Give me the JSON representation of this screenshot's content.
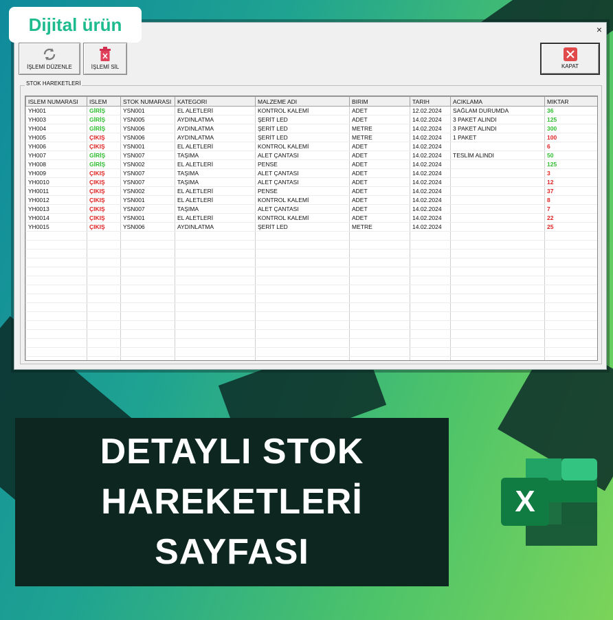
{
  "badge": "Dijital ürün",
  "window": {
    "close_glyph": "×"
  },
  "toolbar": {
    "edit_label": "İŞLEMİ DÜZENLE",
    "delete_label": "İŞLEMİ SİL",
    "close_label": "KAPAT"
  },
  "group_title": "STOK HAREKETLERİ",
  "table": {
    "columns": [
      "ISLEM NUMARASI",
      "ISLEM",
      "STOK NUMARASI",
      "KATEGORI",
      "MALZEME ADI",
      "BIRIM",
      "TARIH",
      "ACIKLAMA",
      "MIKTAR"
    ],
    "rows": [
      [
        "YH001",
        "GİRİŞ",
        "YSN001",
        "EL ALETLERİ",
        "KONTROL KALEMİ",
        "ADET",
        "12.02.2024",
        "SAĞLAM DURUMDA",
        "36"
      ],
      [
        "YH003",
        "GİRİŞ",
        "YSN005",
        "AYDINLATMA",
        "ŞERİT LED",
        "ADET",
        "14.02.2024",
        "3 PAKET ALINDI",
        "125"
      ],
      [
        "YH004",
        "GİRİŞ",
        "YSN006",
        "AYDINLATMA",
        "ŞERİT LED",
        "METRE",
        "14.02.2024",
        "3 PAKET ALINDI",
        "300"
      ],
      [
        "YH005",
        "ÇIKIŞ",
        "YSN006",
        "AYDINLATMA",
        "ŞERİT LED",
        "METRE",
        "14.02.2024",
        "1 PAKET",
        "100"
      ],
      [
        "YH006",
        "ÇIKIŞ",
        "YSN001",
        "EL ALETLERİ",
        "KONTROL KALEMİ",
        "ADET",
        "14.02.2024",
        "",
        "6"
      ],
      [
        "YH007",
        "GİRİŞ",
        "YSN007",
        "TAŞIMA",
        "ALET ÇANTASI",
        "ADET",
        "14.02.2024",
        "TESLİM ALINDI",
        "50"
      ],
      [
        "YH008",
        "GİRİŞ",
        "YSN002",
        "EL ALETLERİ",
        "PENSE",
        "ADET",
        "14.02.2024",
        "",
        "125"
      ],
      [
        "YH009",
        "ÇIKIŞ",
        "YSN007",
        "TAŞIMA",
        "ALET ÇANTASI",
        "ADET",
        "14.02.2024",
        "",
        "3"
      ],
      [
        "YH0010",
        "ÇIKIŞ",
        "YSN007",
        "TAŞIMA",
        "ALET ÇANTASI",
        "ADET",
        "14.02.2024",
        "",
        "12"
      ],
      [
        "YH0011",
        "ÇIKIŞ",
        "YSN002",
        "EL ALETLERİ",
        "PENSE",
        "ADET",
        "14.02.2024",
        "",
        "37"
      ],
      [
        "YH0012",
        "ÇIKIŞ",
        "YSN001",
        "EL ALETLERİ",
        "KONTROL KALEMİ",
        "ADET",
        "14.02.2024",
        "",
        "8"
      ],
      [
        "YH0013",
        "ÇIKIŞ",
        "YSN007",
        "TAŞIMA",
        "ALET ÇANTASI",
        "ADET",
        "14.02.2024",
        "",
        "7"
      ],
      [
        "YH0014",
        "ÇIKIŞ",
        "YSN001",
        "EL ALETLERİ",
        "KONTROL KALEMİ",
        "ADET",
        "14.02.2024",
        "",
        "22"
      ],
      [
        "YH0015",
        "ÇIKIŞ",
        "YSN006",
        "AYDINLATMA",
        "ŞERİT LED",
        "METRE",
        "14.02.2024",
        "",
        "25"
      ]
    ]
  },
  "banner": {
    "line1": "DETAYLI STOK",
    "line2": "HAREKETLERİ",
    "line3": "SAYFASI"
  },
  "excel_logo_letter": "X",
  "colors": {
    "giris": "#2ebd2e",
    "cikis": "#e02020",
    "badge_text": "#1dbb8e",
    "excel_green": "#107c41"
  },
  "icons": {
    "edit": "refresh-icon",
    "delete": "trash-icon",
    "close": "close-icon"
  }
}
